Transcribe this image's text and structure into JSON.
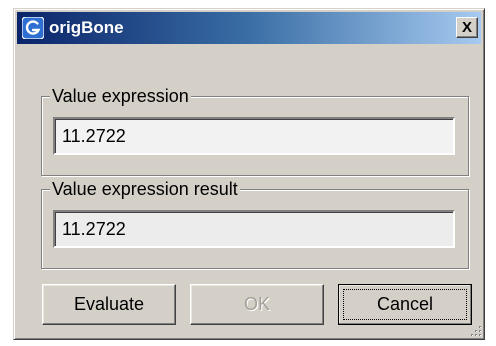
{
  "window": {
    "title": "origBone",
    "close_label": "X"
  },
  "value_group": {
    "legend": "Value expression",
    "value": "11.2722"
  },
  "result_group": {
    "legend": "Value expression result",
    "value": "11.2722"
  },
  "buttons": {
    "evaluate_label": "Evaluate",
    "ok_label": "OK",
    "cancel_label": "Cancel"
  },
  "icons": {
    "app": "app-logo-icon",
    "close": "close-icon",
    "grip": "size-grip-icon"
  },
  "colors": {
    "titlebar_start": "#0a246a",
    "titlebar_end": "#a6caf0",
    "dialog_face": "#d4d0c8"
  }
}
